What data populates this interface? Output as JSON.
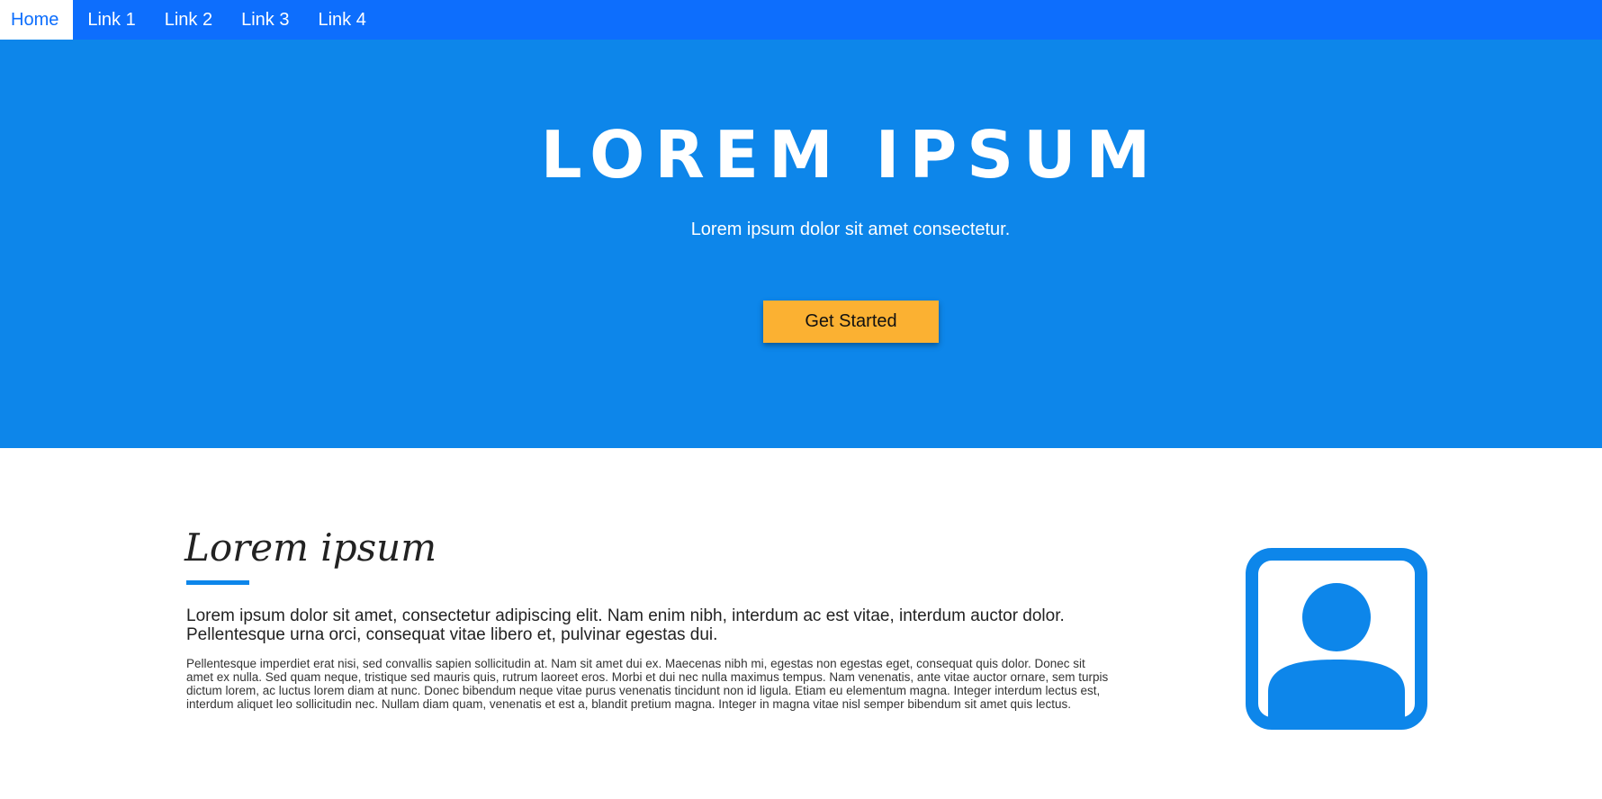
{
  "nav": {
    "items": [
      {
        "label": "Home",
        "active": true
      },
      {
        "label": "Link 1",
        "active": false
      },
      {
        "label": "Link 2",
        "active": false
      },
      {
        "label": "Link 3",
        "active": false
      },
      {
        "label": "Link 4",
        "active": false
      }
    ]
  },
  "hero": {
    "title": "LOREM IPSUM",
    "subtitle": "Lorem ipsum dolor sit amet consectetur.",
    "button_label": "Get Started"
  },
  "about": {
    "heading": "Lorem ipsum",
    "lead": "Lorem ipsum dolor sit amet, consectetur adipiscing elit. Nam enim nibh, interdum ac est vitae, interdum auctor dolor. Pellentesque urna orci, consequat vitae libero et, pulvinar egestas dui.",
    "body": "Pellentesque imperdiet erat nisi, sed convallis sapien sollicitudin at. Nam sit amet dui ex. Maecenas nibh mi, egestas non egestas eget, consequat quis dolor. Donec sit amet ex nulla. Sed quam neque, tristique sed mauris quis, rutrum laoreet eros. Morbi et dui nec nulla maximus tempus. Nam venenatis, ante vitae auctor ornare, sem turpis dictum lorem, ac luctus lorem diam at nunc. Donec bibendum neque vitae purus venenatis tincidunt non id ligula. Etiam eu elementum magna. Integer interdum lectus est, interdum aliquet leo sollicitudin nec. Nullam diam quam, venenatis et est a, blandit pretium magna. Integer in magna vitae nisl semper bibendum sit amet quis lectus.",
    "image_icon": "user-portrait-icon"
  },
  "colors": {
    "nav_bg": "#0d6efd",
    "hero_bg": "#0d86ea",
    "button_bg": "#fbb132",
    "accent": "#0d86ea"
  }
}
